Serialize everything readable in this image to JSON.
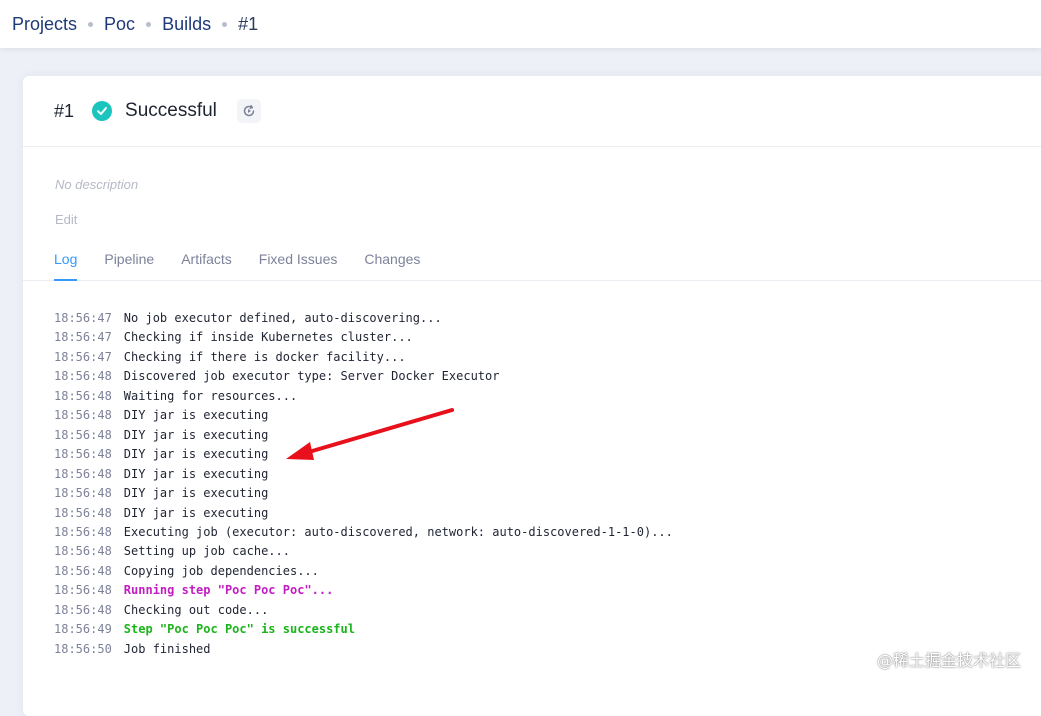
{
  "breadcrumb": {
    "items": [
      "Projects",
      "Poc",
      "Builds"
    ],
    "current": "#1"
  },
  "build": {
    "number": "#1",
    "status": "Successful",
    "status_color": "#1bc5bd",
    "description": "No description",
    "edit_label": "Edit"
  },
  "tabs": [
    {
      "label": "Log",
      "active": true
    },
    {
      "label": "Pipeline",
      "active": false
    },
    {
      "label": "Artifacts",
      "active": false
    },
    {
      "label": "Fixed Issues",
      "active": false
    },
    {
      "label": "Changes",
      "active": false
    }
  ],
  "log": [
    {
      "time": "18:56:47",
      "msg": "No job executor defined, auto-discovering...",
      "style": "normal"
    },
    {
      "time": "18:56:47",
      "msg": "Checking if inside Kubernetes cluster...",
      "style": "normal"
    },
    {
      "time": "18:56:47",
      "msg": "Checking if there is docker facility...",
      "style": "normal"
    },
    {
      "time": "18:56:48",
      "msg": "Discovered job executor type: Server Docker Executor",
      "style": "normal"
    },
    {
      "time": "18:56:48",
      "msg": "Waiting for resources...",
      "style": "normal"
    },
    {
      "time": "18:56:48",
      "msg": "DIY jar is executing",
      "style": "normal"
    },
    {
      "time": "18:56:48",
      "msg": "DIY jar is executing",
      "style": "normal"
    },
    {
      "time": "18:56:48",
      "msg": "DIY jar is executing",
      "style": "normal"
    },
    {
      "time": "18:56:48",
      "msg": "DIY jar is executing",
      "style": "normal"
    },
    {
      "time": "18:56:48",
      "msg": "DIY jar is executing",
      "style": "normal"
    },
    {
      "time": "18:56:48",
      "msg": "DIY jar is executing",
      "style": "normal"
    },
    {
      "time": "18:56:48",
      "msg": "Executing job (executor: auto-discovered, network: auto-discovered-1-1-0)...",
      "style": "normal"
    },
    {
      "time": "18:56:48",
      "msg": "Setting up job cache...",
      "style": "normal"
    },
    {
      "time": "18:56:48",
      "msg": "Copying job dependencies...",
      "style": "normal"
    },
    {
      "time": "18:56:48",
      "msg": "Running step \"Poc Poc Poc\"...",
      "style": "running"
    },
    {
      "time": "18:56:48",
      "msg": "Checking out code...",
      "style": "normal"
    },
    {
      "time": "18:56:49",
      "msg": "Step \"Poc Poc Poc\" is successful",
      "style": "success"
    },
    {
      "time": "18:56:50",
      "msg": "Job finished",
      "style": "normal"
    }
  ],
  "watermark": "@稀土掘金技术社区",
  "colors": {
    "accent": "#3699ff",
    "running": "#c21dc2",
    "success": "#1bb51b",
    "annotation_arrow": "#e8101a"
  }
}
